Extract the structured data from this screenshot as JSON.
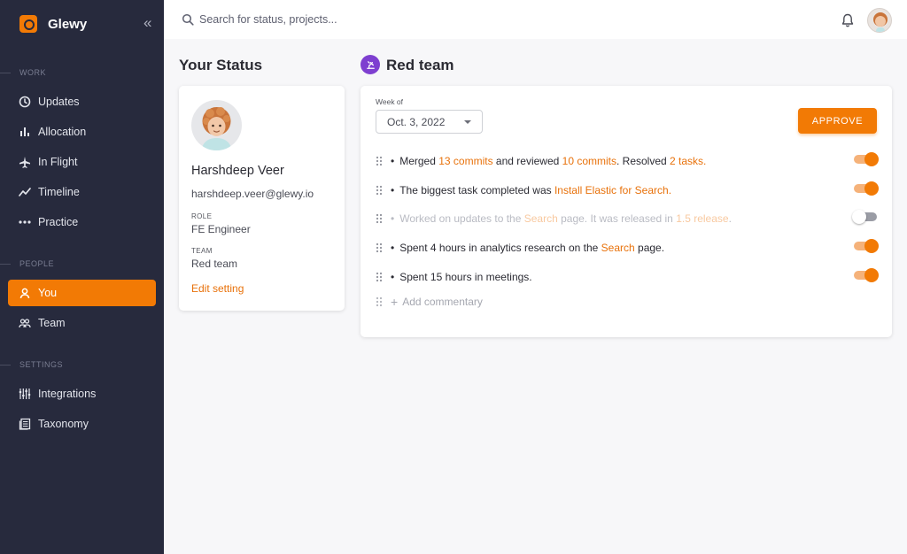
{
  "brand": {
    "name": "Glewy"
  },
  "sidebar": {
    "sections": [
      {
        "label": "WORK",
        "items": [
          {
            "label": "Updates",
            "icon": "updates-icon"
          },
          {
            "label": "Allocation",
            "icon": "bar-chart-icon"
          },
          {
            "label": "In Flight",
            "icon": "airplane-icon"
          },
          {
            "label": "Timeline",
            "icon": "trend-line-icon"
          },
          {
            "label": "Practice",
            "icon": "dots-icon"
          }
        ]
      },
      {
        "label": "PEOPLE",
        "items": [
          {
            "label": "You",
            "icon": "user-icon",
            "active": true
          },
          {
            "label": "Team",
            "icon": "users-icon"
          }
        ]
      },
      {
        "label": "SETTINGS",
        "items": [
          {
            "label": "Integrations",
            "icon": "sliders-icon"
          },
          {
            "label": "Taxonomy",
            "icon": "book-icon"
          }
        ]
      }
    ]
  },
  "topbar": {
    "search_placeholder": "Search for status, projects..."
  },
  "status": {
    "heading": "Your Status",
    "name": "Harshdeep Veer",
    "email": "harshdeep.veer@glewy.io",
    "role_label": "ROLE",
    "role": "FE Engineer",
    "team_label": "TEAM",
    "team": "Red team",
    "edit_label": "Edit setting"
  },
  "team": {
    "heading": "Red team",
    "week_label": "Week of",
    "week_value": "Oct. 3, 2022",
    "approve_label": "APPROVE",
    "add_commentary": "Add commentary",
    "rows": [
      {
        "enabled": true,
        "parts": [
          {
            "t": "Merged "
          },
          {
            "t": "13 commits",
            "hl": true
          },
          {
            "t": " and reviewed "
          },
          {
            "t": "10 commits",
            "hl": true
          },
          {
            "t": ". Resolved "
          },
          {
            "t": "2 tasks.",
            "hl": true
          }
        ]
      },
      {
        "enabled": true,
        "parts": [
          {
            "t": "The biggest task completed was "
          },
          {
            "t": "Install Elastic for Search.",
            "hl": true
          }
        ]
      },
      {
        "enabled": false,
        "parts": [
          {
            "t": "Worked on updates to the "
          },
          {
            "t": "Search",
            "hl": true
          },
          {
            "t": " page. It was released in "
          },
          {
            "t": "1.5 release",
            "hl": true
          },
          {
            "t": "."
          }
        ]
      },
      {
        "enabled": true,
        "parts": [
          {
            "t": "Spent 4 hours in analytics research on the "
          },
          {
            "t": "Search",
            "hl": true
          },
          {
            "t": " page."
          }
        ]
      },
      {
        "enabled": true,
        "parts": [
          {
            "t": "Spent 15 hours in meetings."
          }
        ]
      }
    ]
  },
  "colors": {
    "accent": "#f27a05",
    "sidebar_bg": "#272a3d",
    "team_badge": "#7e3fd0"
  }
}
